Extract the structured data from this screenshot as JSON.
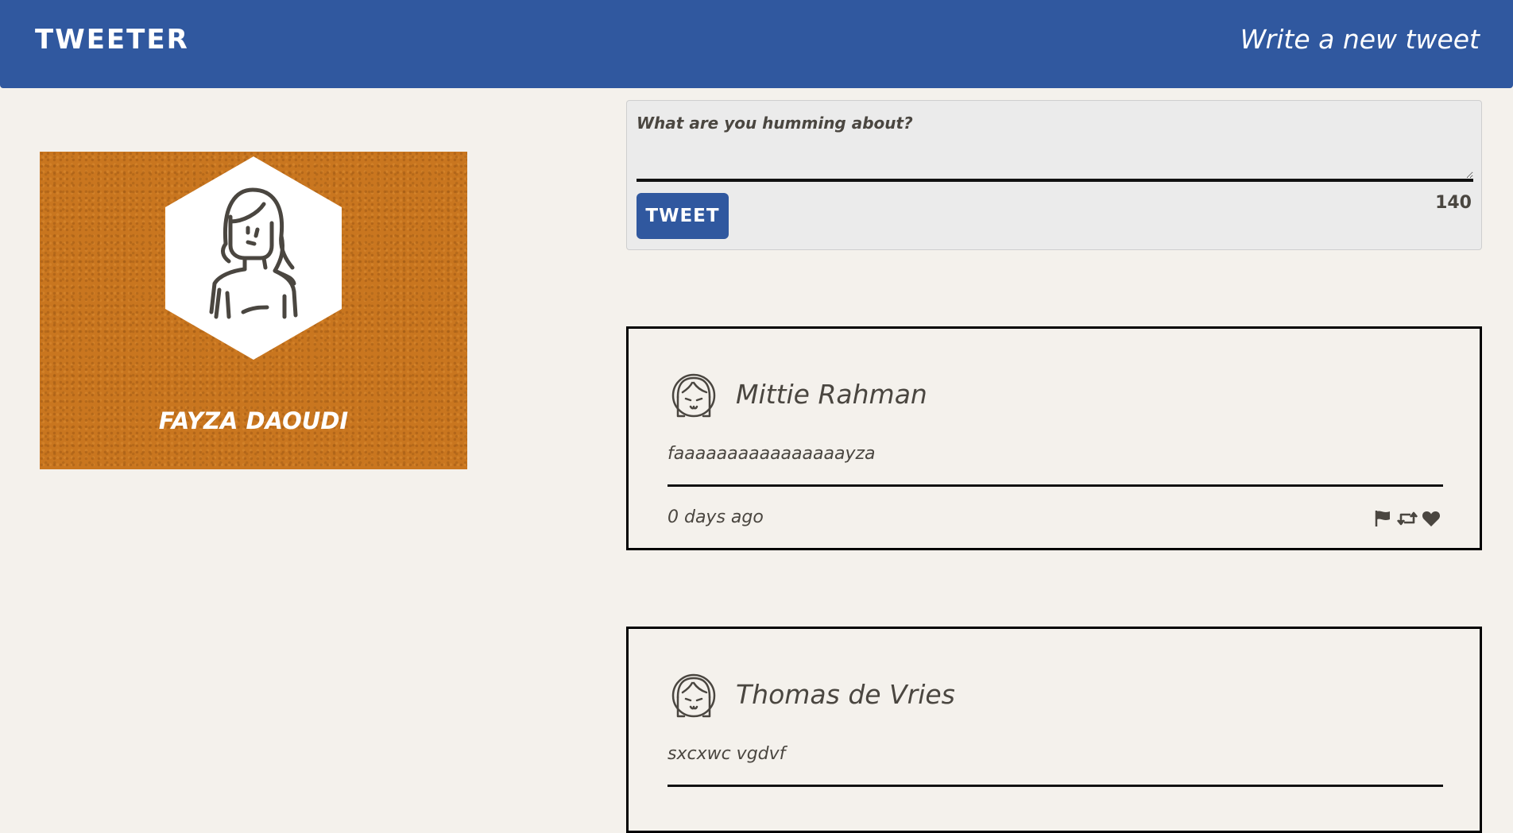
{
  "nav": {
    "brand": "TWEETER",
    "compose_link": "Write a new tweet",
    "color": "#30589f"
  },
  "profile": {
    "name": "FAYZA DAOUDI",
    "background_color": "#c9761f",
    "avatar_icon": "woman-avatar-icon"
  },
  "composer": {
    "placeholder": "What are you humming about?",
    "value": "",
    "button_label": "TWEET",
    "counter": "140"
  },
  "tweets": [
    {
      "author": "Mittie Rahman",
      "avatar_icon": "girl-face-avatar-icon",
      "text": "faaaaaaaaaaaaaaaayza",
      "timestamp": "0 days ago",
      "actions": [
        "flag-icon",
        "retweet-icon",
        "heart-icon"
      ]
    },
    {
      "author": "Thomas de Vries",
      "avatar_icon": "girl-face-avatar-icon",
      "text": "sxcxwc vgdvf",
      "timestamp": "",
      "actions": []
    }
  ],
  "colors": {
    "page_background": "#f4f1ec",
    "text": "#4a4640"
  }
}
